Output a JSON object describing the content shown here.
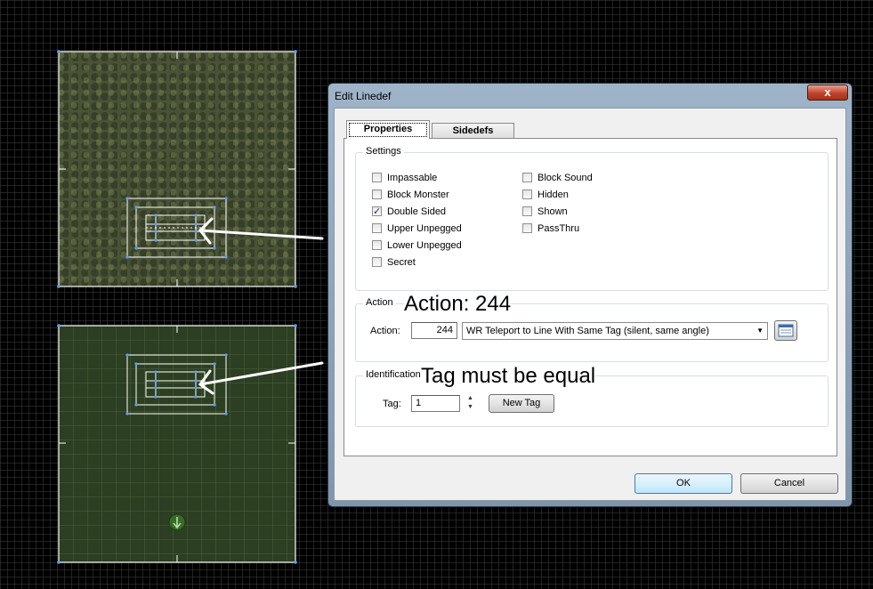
{
  "dialog": {
    "title": "Edit Linedef",
    "close_label": "x",
    "tabs": [
      {
        "label": "Properties",
        "active": true
      },
      {
        "label": "Sidedefs",
        "active": false
      }
    ],
    "settings": {
      "title": "Settings",
      "flags_left": [
        {
          "label": "Impassable",
          "checked": false
        },
        {
          "label": "Block Monster",
          "checked": false
        },
        {
          "label": "Double Sided",
          "checked": true
        },
        {
          "label": "Upper Unpegged",
          "checked": false
        },
        {
          "label": "Lower Unpegged",
          "checked": false
        },
        {
          "label": "Secret",
          "checked": false
        }
      ],
      "flags_right": [
        {
          "label": "Block Sound",
          "checked": false
        },
        {
          "label": "Hidden",
          "checked": false
        },
        {
          "label": "Shown",
          "checked": false
        },
        {
          "label": "PassThru",
          "checked": false
        }
      ]
    },
    "action": {
      "group_title": "Action",
      "annotation": "Action: 244",
      "label": "Action:",
      "value": "244",
      "selected": "WR Teleport to Line With Same Tag (silent, same angle)"
    },
    "identification": {
      "group_title": "Identification",
      "annotation": "Tag must be equal",
      "label": "Tag:",
      "value": "1",
      "new_tag_label": "New Tag"
    },
    "buttons": {
      "ok": "OK",
      "cancel": "Cancel"
    }
  },
  "colors": {
    "map_background": "#000000",
    "linedef_white": "#ffffff",
    "vertex_blue": "#5aa0ff",
    "close_red": "#c0442c"
  },
  "icons": {
    "close": "close-icon",
    "browse": "browse-list-icon",
    "thing": "player-start-icon",
    "spin_up": "chevron-up-icon",
    "spin_down": "chevron-down-icon",
    "select_arrow": "chevron-down-icon"
  }
}
